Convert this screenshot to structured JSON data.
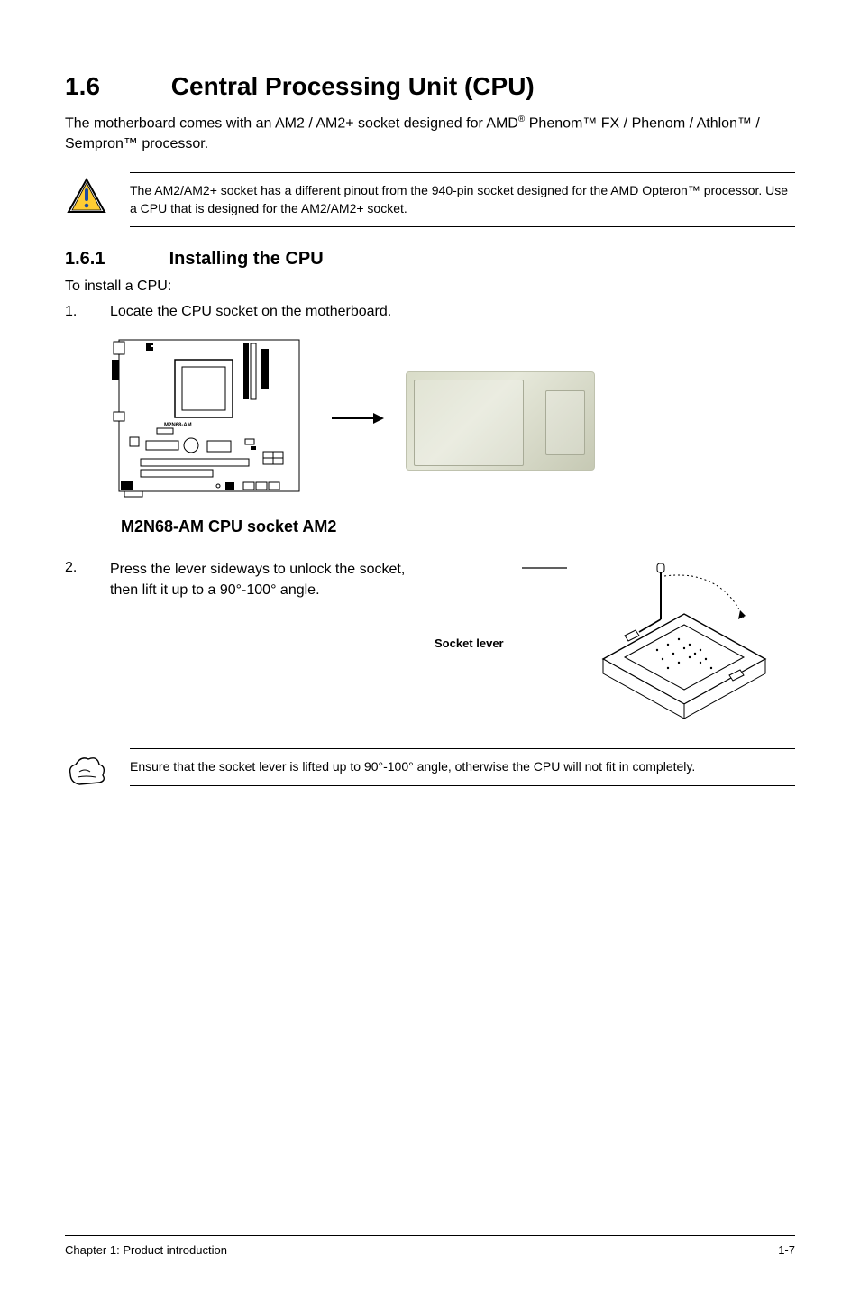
{
  "heading": {
    "num": "1.6",
    "title": "Central Processing Unit (CPU)"
  },
  "intro_part1": "The motherboard comes with an AM2 / AM2+ socket designed for AMD",
  "intro_reg": "®",
  "intro_part2": " Phenom™ FX / Phenom / Athlon™ / Sempron™ processor.",
  "caution_text": "The AM2/AM2+ socket has a different pinout from the 940-pin socket designed for the AMD Opteron™ processor. Use a CPU that is designed for the AM2/AM2+ socket.",
  "subheading": {
    "num": "1.6.1",
    "title": "Installing the CPU"
  },
  "install_intro": "To install a CPU:",
  "step1": {
    "num": "1.",
    "text": "Locate the CPU socket on the motherboard."
  },
  "board_label": "M2N68-AM",
  "fig_caption": "M2N68-AM CPU socket AM2",
  "step2": {
    "num": "2.",
    "text": "Press the lever sideways to unlock the socket, then lift it up to a 90°-100° angle."
  },
  "socket_lever_label": "Socket lever",
  "hand_note": "Ensure that the socket lever is lifted up to 90°-100° angle, otherwise the CPU will not fit in completely.",
  "footer": {
    "left": "Chapter 1: Product introduction",
    "right": "1-7"
  }
}
